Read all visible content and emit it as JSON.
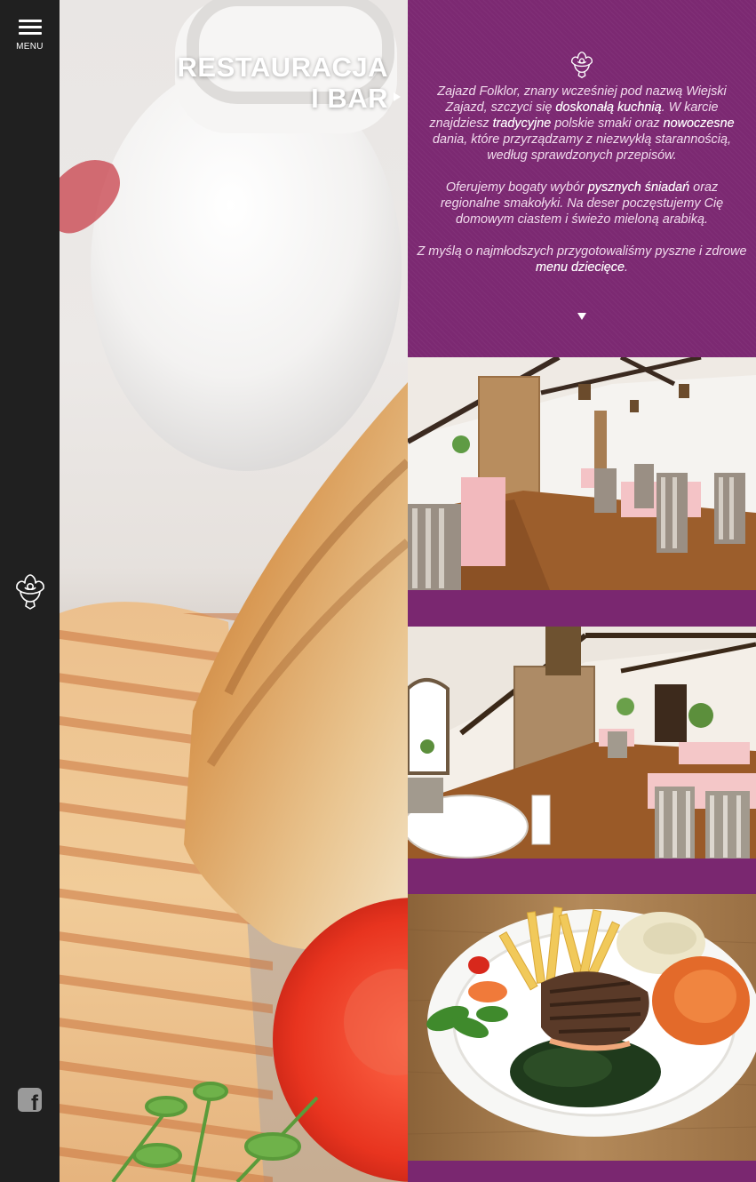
{
  "sidebar": {
    "menu_label": "MENU"
  },
  "hero": {
    "title_line1": "RESTAURACJA",
    "title_line2": "I BAR"
  },
  "intro": {
    "p1": [
      "Zajazd Folklor, znany wcześniej pod nazwą Wiejski Zajazd, szczyci się ",
      "doskonałą kuchnią",
      ". W karcie znajdziesz ",
      "tradycyjne",
      " polskie smaki oraz ",
      "nowoczesne",
      " dania, które przyrządzamy z niezwykłą starannością, według sprawdzonych przepisów."
    ],
    "p2": [
      "Oferujemy bogaty wybór ",
      "pysznych śniadań",
      " oraz regionalne smakołyki. Na deser poczęstujemy Cię domowym ciastem i świeżo mieloną arabiką."
    ],
    "p3": [
      "Z myślą o najmłodszych przygotowaliśmy pyszne i zdrowe ",
      "menu dziecięce",
      "."
    ]
  },
  "colors": {
    "sidebar_bg": "#202020",
    "accent_purple": "#7a2770",
    "text_light": "#f1dbed"
  },
  "icons": {
    "menu": "hamburger-icon",
    "logo": "folk-flower-logo-icon",
    "social": "facebook-icon",
    "hero_arrow": "triangle-right-icon",
    "scroll": "triangle-down-icon"
  }
}
